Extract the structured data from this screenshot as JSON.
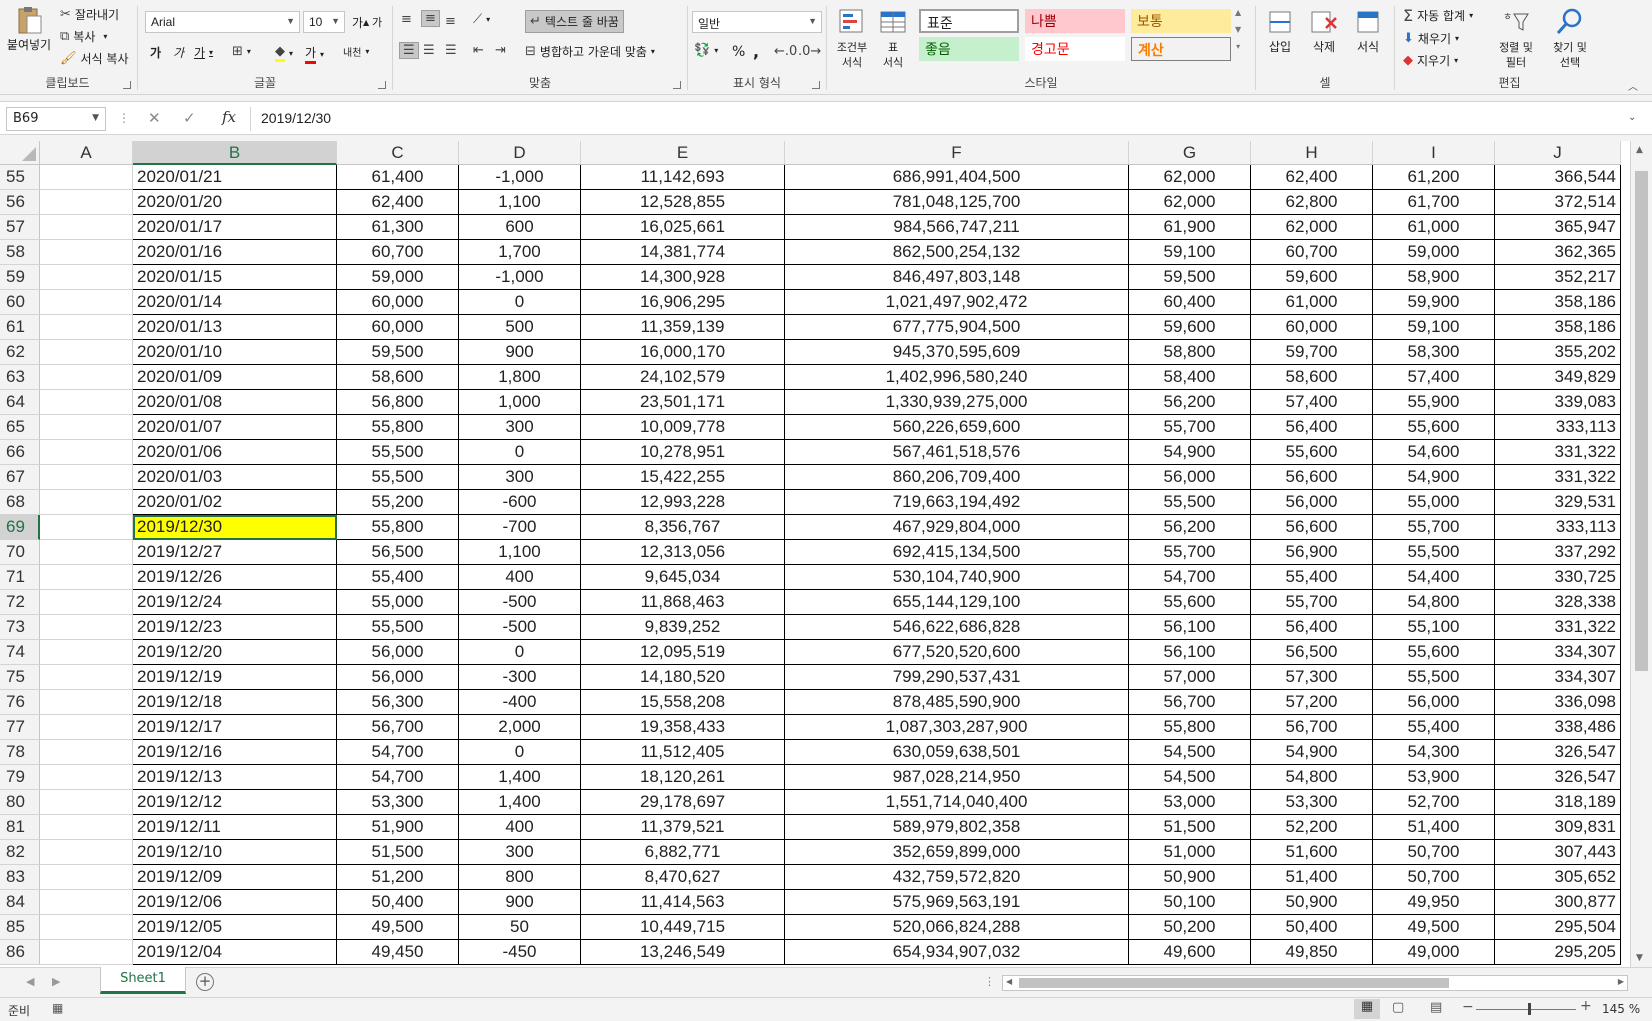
{
  "ribbon": {
    "clipboard": {
      "paste": "붙여넣기",
      "cut": "잘라내기",
      "copy": "복사",
      "format_painter": "서식 복사",
      "label": "클립보드"
    },
    "font": {
      "name": "Arial",
      "size": "10",
      "label": "글꼴",
      "grow": "가",
      "shrink": "가",
      "bold": "가",
      "italic": "가",
      "underline": "가",
      "font_color": "가",
      "phonetic": "내천"
    },
    "alignment": {
      "wrap_text": "텍스트 줄 바꿈",
      "merge_center": "병합하고 가운데 맞춤",
      "label": "맞춤"
    },
    "number": {
      "format": "일반",
      "label": "표시 형식",
      "percent": "%",
      "comma": ","
    },
    "styles": {
      "conditional": "조건부\n서식",
      "format_table": "표\n서식",
      "normal": "표준",
      "bad": "나쁨",
      "neutral": "보통",
      "good": "좋음",
      "warning": "경고문",
      "calculation": "계산",
      "label": "스타일"
    },
    "cells": {
      "insert": "삽입",
      "delete": "삭제",
      "format": "서식",
      "label": "셀"
    },
    "editing": {
      "autosum": "자동 합계",
      "fill": "채우기",
      "clear": "지우기",
      "sort_filter": "정렬 및\n필터",
      "find_select": "찾기 및\n선택",
      "label": "편집"
    }
  },
  "formula_bar": {
    "name_box": "B69",
    "value": "2019/12/30"
  },
  "columns": [
    "A",
    "B",
    "C",
    "D",
    "E",
    "F",
    "G",
    "H",
    "I",
    "J"
  ],
  "selected_cell": {
    "row": "69",
    "col": "B"
  },
  "rows": [
    {
      "n": "55",
      "b": "2020/01/21",
      "c": "61,400",
      "d": "-1,000",
      "e": "11,142,693",
      "f": "686,991,404,500",
      "g": "62,000",
      "h": "62,400",
      "i": "61,200",
      "j": "366,544"
    },
    {
      "n": "56",
      "b": "2020/01/20",
      "c": "62,400",
      "d": "1,100",
      "e": "12,528,855",
      "f": "781,048,125,700",
      "g": "62,000",
      "h": "62,800",
      "i": "61,700",
      "j": "372,514"
    },
    {
      "n": "57",
      "b": "2020/01/17",
      "c": "61,300",
      "d": "600",
      "e": "16,025,661",
      "f": "984,566,747,211",
      "g": "61,900",
      "h": "62,000",
      "i": "61,000",
      "j": "365,947"
    },
    {
      "n": "58",
      "b": "2020/01/16",
      "c": "60,700",
      "d": "1,700",
      "e": "14,381,774",
      "f": "862,500,254,132",
      "g": "59,100",
      "h": "60,700",
      "i": "59,000",
      "j": "362,365"
    },
    {
      "n": "59",
      "b": "2020/01/15",
      "c": "59,000",
      "d": "-1,000",
      "e": "14,300,928",
      "f": "846,497,803,148",
      "g": "59,500",
      "h": "59,600",
      "i": "58,900",
      "j": "352,217"
    },
    {
      "n": "60",
      "b": "2020/01/14",
      "c": "60,000",
      "d": "0",
      "e": "16,906,295",
      "f": "1,021,497,902,472",
      "g": "60,400",
      "h": "61,000",
      "i": "59,900",
      "j": "358,186"
    },
    {
      "n": "61",
      "b": "2020/01/13",
      "c": "60,000",
      "d": "500",
      "e": "11,359,139",
      "f": "677,775,904,500",
      "g": "59,600",
      "h": "60,000",
      "i": "59,100",
      "j": "358,186"
    },
    {
      "n": "62",
      "b": "2020/01/10",
      "c": "59,500",
      "d": "900",
      "e": "16,000,170",
      "f": "945,370,595,609",
      "g": "58,800",
      "h": "59,700",
      "i": "58,300",
      "j": "355,202"
    },
    {
      "n": "63",
      "b": "2020/01/09",
      "c": "58,600",
      "d": "1,800",
      "e": "24,102,579",
      "f": "1,402,996,580,240",
      "g": "58,400",
      "h": "58,600",
      "i": "57,400",
      "j": "349,829"
    },
    {
      "n": "64",
      "b": "2020/01/08",
      "c": "56,800",
      "d": "1,000",
      "e": "23,501,171",
      "f": "1,330,939,275,000",
      "g": "56,200",
      "h": "57,400",
      "i": "55,900",
      "j": "339,083"
    },
    {
      "n": "65",
      "b": "2020/01/07",
      "c": "55,800",
      "d": "300",
      "e": "10,009,778",
      "f": "560,226,659,600",
      "g": "55,700",
      "h": "56,400",
      "i": "55,600",
      "j": "333,113"
    },
    {
      "n": "66",
      "b": "2020/01/06",
      "c": "55,500",
      "d": "0",
      "e": "10,278,951",
      "f": "567,461,518,576",
      "g": "54,900",
      "h": "55,600",
      "i": "54,600",
      "j": "331,322"
    },
    {
      "n": "67",
      "b": "2020/01/03",
      "c": "55,500",
      "d": "300",
      "e": "15,422,255",
      "f": "860,206,709,400",
      "g": "56,000",
      "h": "56,600",
      "i": "54,900",
      "j": "331,322"
    },
    {
      "n": "68",
      "b": "2020/01/02",
      "c": "55,200",
      "d": "-600",
      "e": "12,993,228",
      "f": "719,663,194,492",
      "g": "55,500",
      "h": "56,000",
      "i": "55,000",
      "j": "329,531"
    },
    {
      "n": "69",
      "b": "2019/12/30",
      "c": "55,800",
      "d": "-700",
      "e": "8,356,767",
      "f": "467,929,804,000",
      "g": "56,200",
      "h": "56,600",
      "i": "55,700",
      "j": "333,113"
    },
    {
      "n": "70",
      "b": "2019/12/27",
      "c": "56,500",
      "d": "1,100",
      "e": "12,313,056",
      "f": "692,415,134,500",
      "g": "55,700",
      "h": "56,900",
      "i": "55,500",
      "j": "337,292"
    },
    {
      "n": "71",
      "b": "2019/12/26",
      "c": "55,400",
      "d": "400",
      "e": "9,645,034",
      "f": "530,104,740,900",
      "g": "54,700",
      "h": "55,400",
      "i": "54,400",
      "j": "330,725"
    },
    {
      "n": "72",
      "b": "2019/12/24",
      "c": "55,000",
      "d": "-500",
      "e": "11,868,463",
      "f": "655,144,129,100",
      "g": "55,600",
      "h": "55,700",
      "i": "54,800",
      "j": "328,338"
    },
    {
      "n": "73",
      "b": "2019/12/23",
      "c": "55,500",
      "d": "-500",
      "e": "9,839,252",
      "f": "546,622,686,828",
      "g": "56,100",
      "h": "56,400",
      "i": "55,100",
      "j": "331,322"
    },
    {
      "n": "74",
      "b": "2019/12/20",
      "c": "56,000",
      "d": "0",
      "e": "12,095,519",
      "f": "677,520,520,600",
      "g": "56,100",
      "h": "56,500",
      "i": "55,600",
      "j": "334,307"
    },
    {
      "n": "75",
      "b": "2019/12/19",
      "c": "56,000",
      "d": "-300",
      "e": "14,180,520",
      "f": "799,290,537,431",
      "g": "57,000",
      "h": "57,300",
      "i": "55,500",
      "j": "334,307"
    },
    {
      "n": "76",
      "b": "2019/12/18",
      "c": "56,300",
      "d": "-400",
      "e": "15,558,208",
      "f": "878,485,590,900",
      "g": "56,700",
      "h": "57,200",
      "i": "56,000",
      "j": "336,098"
    },
    {
      "n": "77",
      "b": "2019/12/17",
      "c": "56,700",
      "d": "2,000",
      "e": "19,358,433",
      "f": "1,087,303,287,900",
      "g": "55,800",
      "h": "56,700",
      "i": "55,400",
      "j": "338,486"
    },
    {
      "n": "78",
      "b": "2019/12/16",
      "c": "54,700",
      "d": "0",
      "e": "11,512,405",
      "f": "630,059,638,501",
      "g": "54,500",
      "h": "54,900",
      "i": "54,300",
      "j": "326,547"
    },
    {
      "n": "79",
      "b": "2019/12/13",
      "c": "54,700",
      "d": "1,400",
      "e": "18,120,261",
      "f": "987,028,214,950",
      "g": "54,500",
      "h": "54,800",
      "i": "53,900",
      "j": "326,547"
    },
    {
      "n": "80",
      "b": "2019/12/12",
      "c": "53,300",
      "d": "1,400",
      "e": "29,178,697",
      "f": "1,551,714,040,400",
      "g": "53,000",
      "h": "53,300",
      "i": "52,700",
      "j": "318,189"
    },
    {
      "n": "81",
      "b": "2019/12/11",
      "c": "51,900",
      "d": "400",
      "e": "11,379,521",
      "f": "589,979,802,358",
      "g": "51,500",
      "h": "52,200",
      "i": "51,400",
      "j": "309,831"
    },
    {
      "n": "82",
      "b": "2019/12/10",
      "c": "51,500",
      "d": "300",
      "e": "6,882,771",
      "f": "352,659,899,000",
      "g": "51,000",
      "h": "51,600",
      "i": "50,700",
      "j": "307,443"
    },
    {
      "n": "83",
      "b": "2019/12/09",
      "c": "51,200",
      "d": "800",
      "e": "8,470,627",
      "f": "432,759,572,820",
      "g": "50,900",
      "h": "51,400",
      "i": "50,700",
      "j": "305,652"
    },
    {
      "n": "84",
      "b": "2019/12/06",
      "c": "50,400",
      "d": "900",
      "e": "11,414,563",
      "f": "575,969,563,191",
      "g": "50,100",
      "h": "50,900",
      "i": "49,950",
      "j": "300,877"
    },
    {
      "n": "85",
      "b": "2019/12/05",
      "c": "49,500",
      "d": "50",
      "e": "10,449,715",
      "f": "520,066,824,288",
      "g": "50,200",
      "h": "50,400",
      "i": "49,500",
      "j": "295,504"
    },
    {
      "n": "86",
      "b": "2019/12/04",
      "c": "49,450",
      "d": "-450",
      "e": "13,246,549",
      "f": "654,934,907,032",
      "g": "49,600",
      "h": "49,850",
      "i": "49,000",
      "j": "295,205"
    }
  ],
  "sheet_tabs": [
    "Sheet1"
  ],
  "status": {
    "ready": "준비",
    "zoom": "145 %"
  },
  "colors": {
    "accent": "#217346",
    "highlight": "#ffff00",
    "bad_bg": "#ffc7ce",
    "bad_fg": "#9c0006",
    "neutral_bg": "#ffeb9c",
    "neutral_fg": "#9c5700",
    "good_bg": "#c6efce",
    "good_fg": "#006100",
    "calc_fg": "#fa7d00"
  }
}
